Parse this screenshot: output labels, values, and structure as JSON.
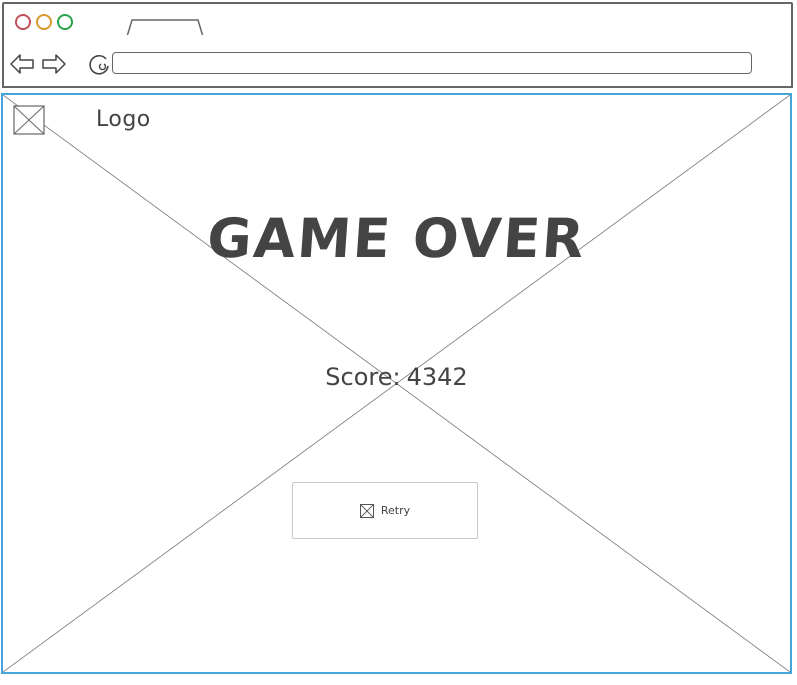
{
  "browser": {
    "url_value": ""
  },
  "header": {
    "logo_label": "Logo"
  },
  "main": {
    "title": "GAME OVER",
    "score_label": "Score:",
    "score_value": "4342",
    "retry_label": "Retry"
  },
  "colors": {
    "content_border": "#41a6d8",
    "chrome_border": "#666666",
    "text": "#444444",
    "dot_red": "#c0505a",
    "dot_orange": "#d89a2a",
    "dot_green": "#2aa34a"
  },
  "icons": {
    "image_placeholder": "image-placeholder-icon",
    "back": "arrow-left-icon",
    "forward": "arrow-right-icon",
    "reload": "reload-icon"
  }
}
